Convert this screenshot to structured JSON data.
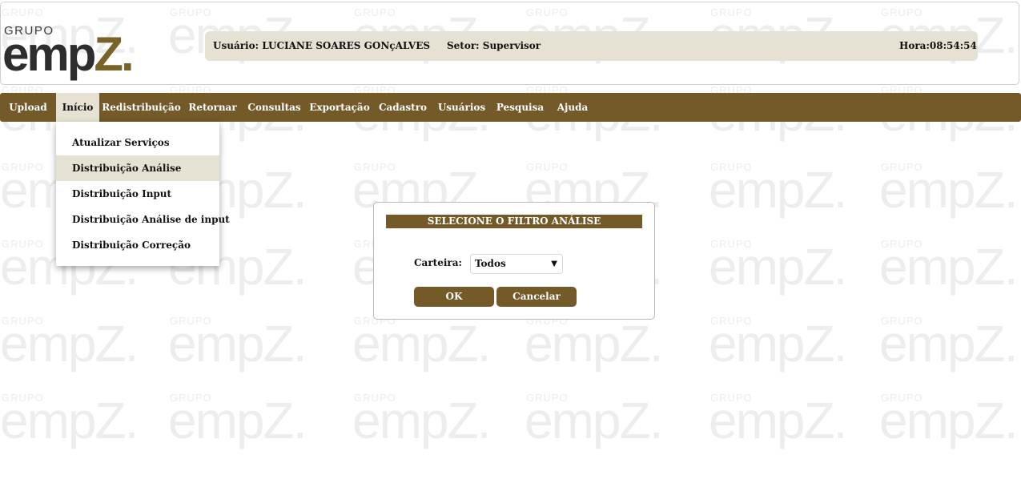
{
  "watermark": {
    "small": "GRUPO",
    "big": "empZ."
  },
  "logo": {
    "small": "GRUPO",
    "big_main": "emp",
    "big_accent": "Z",
    "big_dot": "."
  },
  "infobar": {
    "user": "Usuário: LUCIANE SOARES GONçALVES",
    "sector": "Setor: Supervisor",
    "time": "Hora:08:54:54"
  },
  "menu": [
    "Upload",
    "Início",
    "Redistribuição",
    "Retornar",
    "Consultas",
    "Exportação",
    "Cadastro",
    "Usuários",
    "Pesquisa",
    "Ajuda"
  ],
  "active_menu": "Início",
  "dropdown": [
    "Atualizar Serviços",
    "Distribuição Análise",
    "Distribuição Input",
    "Distribuição Análise de input",
    "Distribuição Correção"
  ],
  "hovered_dropdown_item": "Distribuição Análise",
  "dialog": {
    "title": "SELECIONE O FILTRO ANÁLISE",
    "carteira_label": "Carteira:",
    "carteira_value": "Todos",
    "ok_label": "OK",
    "cancel_label": "Cancelar"
  },
  "colors": {
    "brand_brown": "#735a28",
    "beige": "#e6e2d3"
  }
}
